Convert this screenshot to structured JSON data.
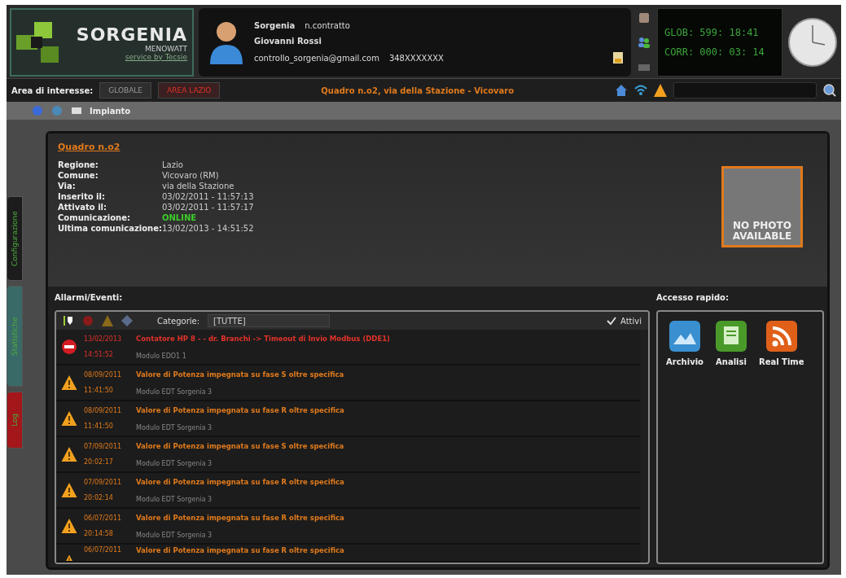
{
  "header": {
    "logo": {
      "brand": "SORGENIA",
      "sub": "MENOWATT",
      "tagline": "service by Tecsie"
    },
    "user": {
      "company": "Sorgenia",
      "contract": "n.contratto",
      "name": "Giovanni Rossi",
      "email": "controllo_sorgenia@gmail.com",
      "phone": "348XXXXXXX"
    },
    "counters": [
      "GLOB: 599: 18:41",
      "CORR: 000: 03: 14"
    ]
  },
  "nav": {
    "label": "Area di interesse:",
    "areas": [
      {
        "label": "GLOBALE",
        "selected": false
      },
      {
        "label": "AREA LAZIO",
        "selected": true
      }
    ],
    "location": "Quadro n.o2, via della Stazione - Vicovaro"
  },
  "breadcrumb": "Impianto",
  "side_tabs": [
    {
      "label": "Configurazione",
      "color": "#1c1c1c"
    },
    {
      "label": "Statistiche",
      "color": "#3a6a68"
    },
    {
      "label": "Log",
      "color": "#a3161a"
    }
  ],
  "details": {
    "title": "Quadro n.o2",
    "fields": [
      {
        "label": "Regione:",
        "value": "Lazio",
        "kind": "text"
      },
      {
        "label": "Comune:",
        "value": "Vicovaro (RM)",
        "kind": "text"
      },
      {
        "label": "Via:",
        "value": "via della Stazione",
        "kind": "text"
      },
      {
        "label": "Inserito il:",
        "value": "03/02/2011 - 11:57:13",
        "kind": "text"
      },
      {
        "label": "Attivato il:",
        "value": "03/02/2011 - 11:57:17",
        "kind": "text"
      },
      {
        "label": "Comunicazione:",
        "value": "ONLINE",
        "kind": "status"
      },
      {
        "label": "Ultima comunicazione:",
        "value": "13/02/2013 - 14:51:52",
        "kind": "text"
      }
    ],
    "photo": [
      "NO PHOTO",
      "AVAILABLE"
    ]
  },
  "alarms": {
    "title": "Allarmi/Eventi:",
    "filter_label": "Categorie:",
    "category": "[TUTTE]",
    "active": {
      "label": "Attivi",
      "checked": true
    },
    "rows": [
      {
        "kind": "error",
        "date": "13/02/2013",
        "time": "14:51:52",
        "message": "Contatore HP 8 - - dr. Branchi -> Timeout di Invio Modbus (DDE1)",
        "module": "Modulo EDO1 1"
      },
      {
        "kind": "warning",
        "date": "08/09/2011",
        "time": "11:41:50",
        "message": "Valore di Potenza impegnata su fase S oltre specifica",
        "module": "Modulo EDT Sorgenia 3"
      },
      {
        "kind": "warning",
        "date": "08/09/2011",
        "time": "11:41:50",
        "message": "Valore di Potenza impegnata su fase R oltre specifica",
        "module": "Modulo EDT Sorgenia 3"
      },
      {
        "kind": "warning",
        "date": "07/09/2011",
        "time": "20:02:17",
        "message": "Valore di Potenza impegnata su fase S oltre specifica",
        "module": "Modulo EDT Sorgenia 3"
      },
      {
        "kind": "warning",
        "date": "07/09/2011",
        "time": "20:02:14",
        "message": "Valore di Potenza impegnata su fase R oltre specifica",
        "module": "Modulo EDT Sorgenia 3"
      },
      {
        "kind": "warning",
        "date": "06/07/2011",
        "time": "20:14:58",
        "message": "Valore di Potenza impegnata su fase R oltre specifica",
        "module": "Modulo EDT Sorgenia 3"
      },
      {
        "kind": "warning",
        "date": "06/07/2011",
        "message": "Valore di Potenza impegnata su fase R oltre specifica"
      }
    ]
  },
  "quick_access": {
    "title": "Accesso rapido:",
    "items": [
      {
        "kind": "archive",
        "label": "Archivio"
      },
      {
        "kind": "analysis",
        "label": "Analisi"
      },
      {
        "kind": "realtime",
        "label": "Real Time"
      }
    ]
  }
}
